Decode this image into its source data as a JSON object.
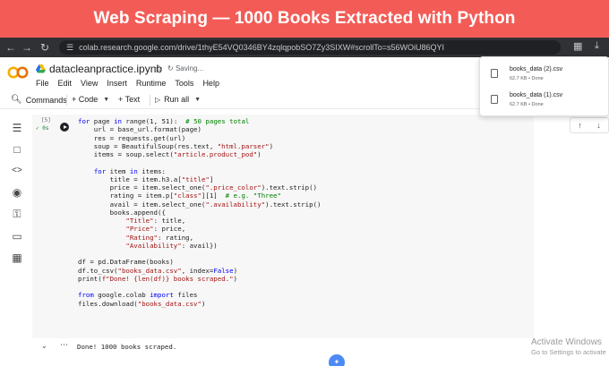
{
  "banner": {
    "title": "Web Scraping — 1000 Books Extracted with Python",
    "bg_color": "#f35c56"
  },
  "browser": {
    "url": "colab.research.google.com/drive/1thyE54VQ0346BY4zqlqpobSO7Zy3SIXW#scrollTo=s56WOiU86QYI"
  },
  "notebook": {
    "file_name": "datacleanpractice.ipynb",
    "save_status": "Saving...",
    "menu": [
      "File",
      "Edit",
      "View",
      "Insert",
      "Runtime",
      "Tools",
      "Help"
    ]
  },
  "toolbar": {
    "commands": "Commands",
    "code": "+ Code",
    "text": "+ Text",
    "run_all": "Run all"
  },
  "cell": {
    "execution_count": "[5]",
    "status": "0s",
    "code_lines": [
      [
        {
          "t": "for",
          "c": "k"
        },
        {
          "t": " page "
        },
        {
          "t": "in",
          "c": "k"
        },
        {
          "t": " range(1, 51):  "
        },
        {
          "t": "# 50 pages total",
          "c": "c"
        }
      ],
      [
        {
          "t": "    url = base_url.format(page)"
        }
      ],
      [
        {
          "t": "    res = requests.get(url)"
        }
      ],
      [
        {
          "t": "    soup = BeautifulSoup(res.text, "
        },
        {
          "t": "\"html.parser\"",
          "c": "s"
        },
        {
          "t": ")"
        }
      ],
      [
        {
          "t": "    items = soup.select("
        },
        {
          "t": "\"article.product_pod\"",
          "c": "s"
        },
        {
          "t": ")"
        }
      ],
      [
        {
          "t": ""
        }
      ],
      [
        {
          "t": "    "
        },
        {
          "t": "for",
          "c": "k"
        },
        {
          "t": " item "
        },
        {
          "t": "in",
          "c": "k"
        },
        {
          "t": " items:"
        }
      ],
      [
        {
          "t": "        title = item.h3.a["
        },
        {
          "t": "\"title\"",
          "c": "s"
        },
        {
          "t": "]"
        }
      ],
      [
        {
          "t": "        price = item.select_one("
        },
        {
          "t": "\".price_color\"",
          "c": "s"
        },
        {
          "t": ").text.strip()"
        }
      ],
      [
        {
          "t": "        rating = item.p["
        },
        {
          "t": "\"class\"",
          "c": "s"
        },
        {
          "t": "][1]  "
        },
        {
          "t": "# e.g. \"Three\"",
          "c": "c"
        }
      ],
      [
        {
          "t": "        avail = item.select_one("
        },
        {
          "t": "\".availability\"",
          "c": "s"
        },
        {
          "t": ").text.strip()"
        }
      ],
      [
        {
          "t": "        books.append({"
        }
      ],
      [
        {
          "t": "            "
        },
        {
          "t": "\"Title\"",
          "c": "s"
        },
        {
          "t": ": title,"
        }
      ],
      [
        {
          "t": "            "
        },
        {
          "t": "\"Price\"",
          "c": "s"
        },
        {
          "t": ": price,"
        }
      ],
      [
        {
          "t": "            "
        },
        {
          "t": "\"Rating\"",
          "c": "s"
        },
        {
          "t": ": rating,"
        }
      ],
      [
        {
          "t": "            "
        },
        {
          "t": "\"Availability\"",
          "c": "s"
        },
        {
          "t": ": avail})"
        }
      ],
      [
        {
          "t": ""
        }
      ],
      [
        {
          "t": "df = pd.DataFrame(books)"
        }
      ],
      [
        {
          "t": "df.to_csv("
        },
        {
          "t": "\"books_data.csv\"",
          "c": "s"
        },
        {
          "t": ", index="
        },
        {
          "t": "False",
          "c": "k"
        },
        {
          "t": ")"
        }
      ],
      [
        {
          "t": "print("
        },
        {
          "t": "f\"Done! {len(df)} books scraped.\"",
          "c": "s"
        },
        {
          "t": ")"
        }
      ],
      [
        {
          "t": ""
        }
      ],
      [
        {
          "t": "from",
          "c": "k"
        },
        {
          "t": " google.colab "
        },
        {
          "t": "import",
          "c": "k"
        },
        {
          "t": " files"
        }
      ],
      [
        {
          "t": "files.download("
        },
        {
          "t": "\"books_data.csv\"",
          "c": "s"
        },
        {
          "t": ")"
        }
      ]
    ],
    "output": "Done! 1000 books scraped."
  },
  "downloads": [
    {
      "name": "books_data (2).csv",
      "meta": "62.7 KB • Done"
    },
    {
      "name": "books_data (1).csv",
      "meta": "62.7 KB • Done"
    }
  ],
  "watermark": {
    "title": "Activate Windows",
    "subtitle": "Go to Settings to activate"
  }
}
